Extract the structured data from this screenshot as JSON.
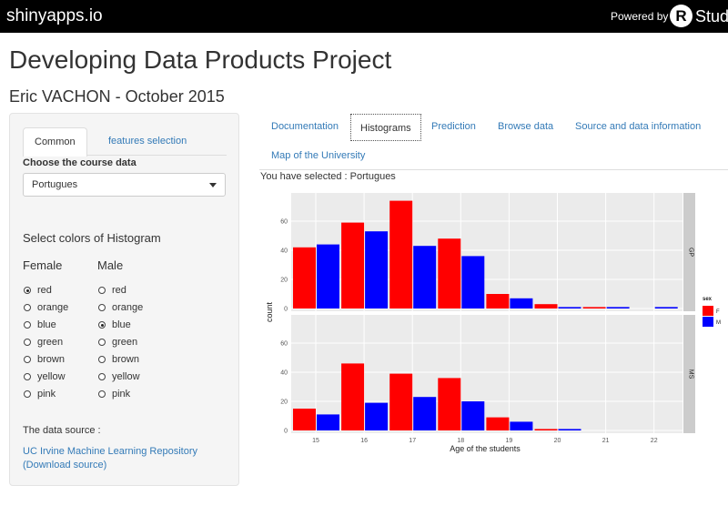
{
  "topbar": {
    "brand": "shinyapps.io",
    "powered": "Powered by",
    "r_logo": "R",
    "studio": "Studio"
  },
  "page": {
    "title": "Developing Data Products Project",
    "subtitle": "Eric VACHON - October 2015"
  },
  "sidebar": {
    "tabs": [
      {
        "label": "Common"
      },
      {
        "label": "features selection"
      }
    ],
    "course_label": "Choose the course data",
    "course_value": "Portugues",
    "colors_title": "Select colors of Histogram",
    "female_title": "Female",
    "male_title": "Male",
    "color_options": [
      "red",
      "orange",
      "blue",
      "green",
      "brown",
      "yellow",
      "pink"
    ],
    "female_selected": "red",
    "male_selected": "blue",
    "source_label": "The data source :",
    "source_link1": "UC Irvine Machine Learning Repository",
    "source_link2": "(Download source)"
  },
  "nav": {
    "tabs": [
      {
        "label": "Documentation"
      },
      {
        "label": "Histograms"
      },
      {
        "label": "Prediction"
      },
      {
        "label": "Browse data"
      },
      {
        "label": "Source and data information"
      },
      {
        "label": "Map of the University"
      }
    ],
    "active": "Histograms"
  },
  "selected_text": "You have selected : Portugues",
  "chart_data": {
    "type": "bar",
    "xlabel": "Age of the students",
    "ylabel": "count",
    "categories": [
      "15",
      "16",
      "17",
      "18",
      "19",
      "20",
      "21",
      "22"
    ],
    "ylim": [
      0,
      75
    ],
    "yticks": [
      0,
      20,
      40,
      60
    ],
    "legend": {
      "title": "sex",
      "position": "right",
      "entries": [
        "F",
        "M"
      ]
    },
    "colors": {
      "F": "#ff0000",
      "M": "#0000ff"
    },
    "panel_bg": "#ebebeb",
    "strip_bg": "#cccccc",
    "grid": true,
    "panels": [
      {
        "label": "GP",
        "series": [
          {
            "name": "F",
            "values": [
              42,
              59,
              74,
              48,
              10,
              3,
              1,
              0
            ]
          },
          {
            "name": "M",
            "values": [
              44,
              53,
              43,
              36,
              7,
              1,
              1,
              1
            ]
          }
        ]
      },
      {
        "label": "MS",
        "series": [
          {
            "name": "F",
            "values": [
              15,
              46,
              39,
              36,
              9,
              1,
              0,
              0
            ]
          },
          {
            "name": "M",
            "values": [
              11,
              19,
              23,
              20,
              6,
              1,
              0,
              0
            ]
          }
        ]
      }
    ]
  }
}
